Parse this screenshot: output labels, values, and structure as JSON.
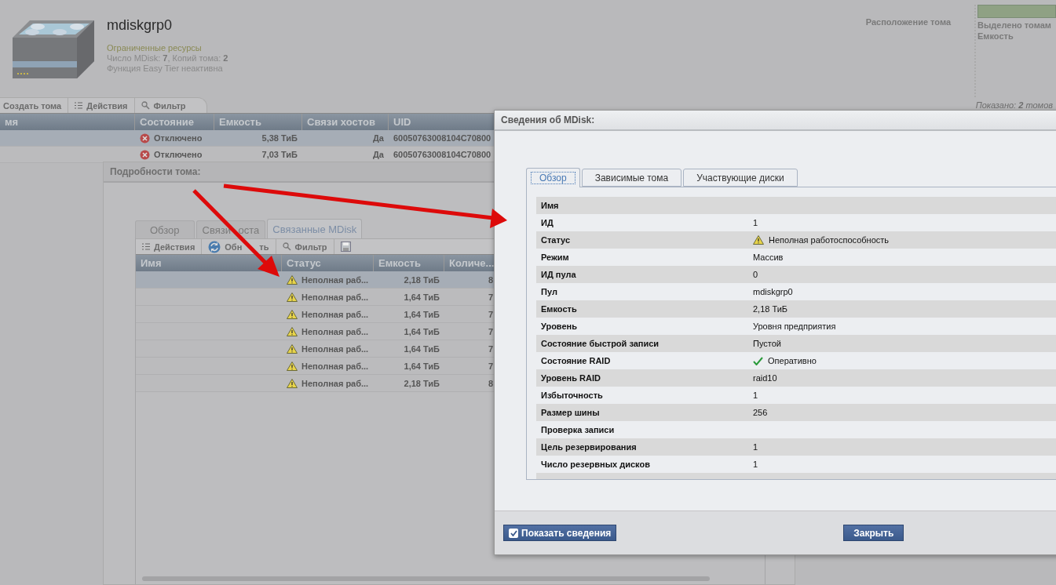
{
  "pool": {
    "name": "mdiskgrp0",
    "status": "Ограниченные ресурсы",
    "counts": "Число MDisk: **7**, Копий тома: **2**",
    "easy_tier": "Функция Easy Tier неактивна"
  },
  "volume_location": {
    "title": "Расположение тома",
    "allocated": "Выделено томам",
    "capacity": "Емкость"
  },
  "toolbar": [
    {
      "label": "Создать тома",
      "kind": "plain"
    },
    {
      "label": "Действия",
      "kind": "list"
    },
    {
      "label": "Фильтр",
      "kind": "search"
    }
  ],
  "shown": "Показано: **2** томов",
  "volumes_table": {
    "columns": [
      "мя",
      "Состояние",
      "Емкость",
      "Связи хостов",
      "UID"
    ],
    "rows": [
      {
        "selected": true,
        "kind": "error",
        "status": "Отключено",
        "capacity": "5,38 ТиБ",
        "host_mappings": "Да",
        "uid": "60050763008104C70800"
      },
      {
        "selected": false,
        "kind": "error",
        "status": "Отключено",
        "capacity": "7,03 ТиБ",
        "host_mappings": "Да",
        "uid": "60050763008104C70800"
      }
    ]
  },
  "volume_details": {
    "title": "Подробности тома:",
    "tabs": [
      {
        "label": "Обзор",
        "selected": false
      },
      {
        "label": "Связи оста",
        "selected": false
      },
      {
        "label": "Связанные MDisk",
        "selected": true
      }
    ],
    "toolbar": [
      {
        "label": "Действия",
        "kind": "list"
      },
      {
        "label": "Обн ть",
        "kind": "refresh"
      },
      {
        "label": "Фильтр",
        "kind": "search"
      },
      {
        "kind": "save"
      }
    ],
    "columns": [
      "Имя",
      "Статус",
      "Емкость",
      "Количе..."
    ],
    "rows": [
      {
        "selected": true,
        "kind": "warning",
        "status": "Неполная раб...",
        "capacity": "2,18 ТиБ",
        "column_4": "8"
      },
      {
        "selected": false,
        "kind": "warning",
        "status": "Неполная раб...",
        "capacity": "1,64 ТиБ",
        "column_4": "7"
      },
      {
        "selected": false,
        "kind": "warning",
        "status": "Неполная раб...",
        "capacity": "1,64 ТиБ",
        "column_4": "7"
      },
      {
        "selected": false,
        "kind": "warning",
        "status": "Неполная раб...",
        "capacity": "1,64 ТиБ",
        "column_4": "7"
      },
      {
        "selected": false,
        "kind": "warning",
        "status": "Неполная раб...",
        "capacity": "1,64 ТиБ",
        "column_4": "7"
      },
      {
        "selected": false,
        "kind": "warning",
        "status": "Неполная раб...",
        "capacity": "1,64 ТиБ",
        "column_4": "7"
      },
      {
        "selected": false,
        "kind": "warning",
        "status": "Неполная раб...",
        "capacity": "2,18 ТиБ",
        "column_4": "8"
      }
    ]
  },
  "mdisk_dialog": {
    "title": "Сведения об MDisk:",
    "tabs": [
      {
        "label": "Обзор",
        "selected": true
      },
      {
        "label": "Зависимые тома",
        "selected": false
      },
      {
        "label": "Участвующие диски",
        "selected": false
      }
    ],
    "properties": [
      {
        "label": "Имя"
      },
      {
        "label": "ИД",
        "value": "1",
        "kind": "plain"
      },
      {
        "label": "Статус",
        "value": "Неполная работоспособность",
        "kind": "warning"
      },
      {
        "label": "Режим",
        "value": "Массив",
        "kind": "plain"
      },
      {
        "label": "ИД пула",
        "value": "0",
        "kind": "plain"
      },
      {
        "label": "Пул",
        "value": "mdiskgrp0",
        "kind": "plain"
      },
      {
        "label": "Емкость",
        "value": "2,18 ТиБ",
        "kind": "plain"
      },
      {
        "label": "Уровень",
        "value": "Уровня предприятия",
        "kind": "plain"
      },
      {
        "label": "Состояние быстрой записи",
        "value": "Пустой",
        "kind": "plain"
      },
      {
        "label": "Состояние RAID",
        "value": "Оперативно",
        "kind": "check"
      },
      {
        "label": "Уровень RAID",
        "value": "raid10",
        "kind": "plain"
      },
      {
        "label": "Избыточность",
        "value": "1",
        "kind": "plain"
      },
      {
        "label": "Размер шины",
        "value": "256",
        "kind": "plain"
      },
      {
        "label": "Проверка записи"
      },
      {
        "label": "Цель резервирования",
        "value": "1",
        "kind": "plain"
      },
      {
        "label": "Число резервных дисков",
        "value": "1",
        "kind": "plain"
      }
    ],
    "show_details": {
      "label": "Показать сведения",
      "checked": true
    },
    "close": "Закрыть"
  }
}
